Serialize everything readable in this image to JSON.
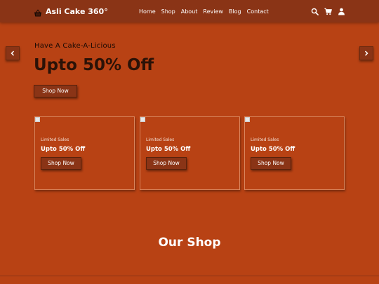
{
  "brand": {
    "name": "Asli Cake 360°",
    "icon": "basket-icon"
  },
  "nav": {
    "links": [
      "Home",
      "Shop",
      "About",
      "Review",
      "Blog",
      "Contact"
    ],
    "icons": [
      "search-icon",
      "cart-icon",
      "user-icon"
    ]
  },
  "hero": {
    "subtitle": "Have A Cake-A-Licious",
    "title": "Upto 50% Off",
    "button": "Shop Now"
  },
  "cards": [
    {
      "label": "Limited Sales",
      "title": "Upto 50% Off",
      "button": "Shop Now"
    },
    {
      "label": "Limited Sales",
      "title": "Upto 50% Off",
      "button": "Shop Now"
    },
    {
      "label": "Limited Sales",
      "title": "Upto 50% Off",
      "button": "Shop Now"
    }
  ],
  "section": {
    "title": "Our Shop"
  },
  "colors": {
    "background": "#b84214",
    "navbar": "#8a3416",
    "button": "#8a3416",
    "heading_dark": "#2b1207"
  }
}
